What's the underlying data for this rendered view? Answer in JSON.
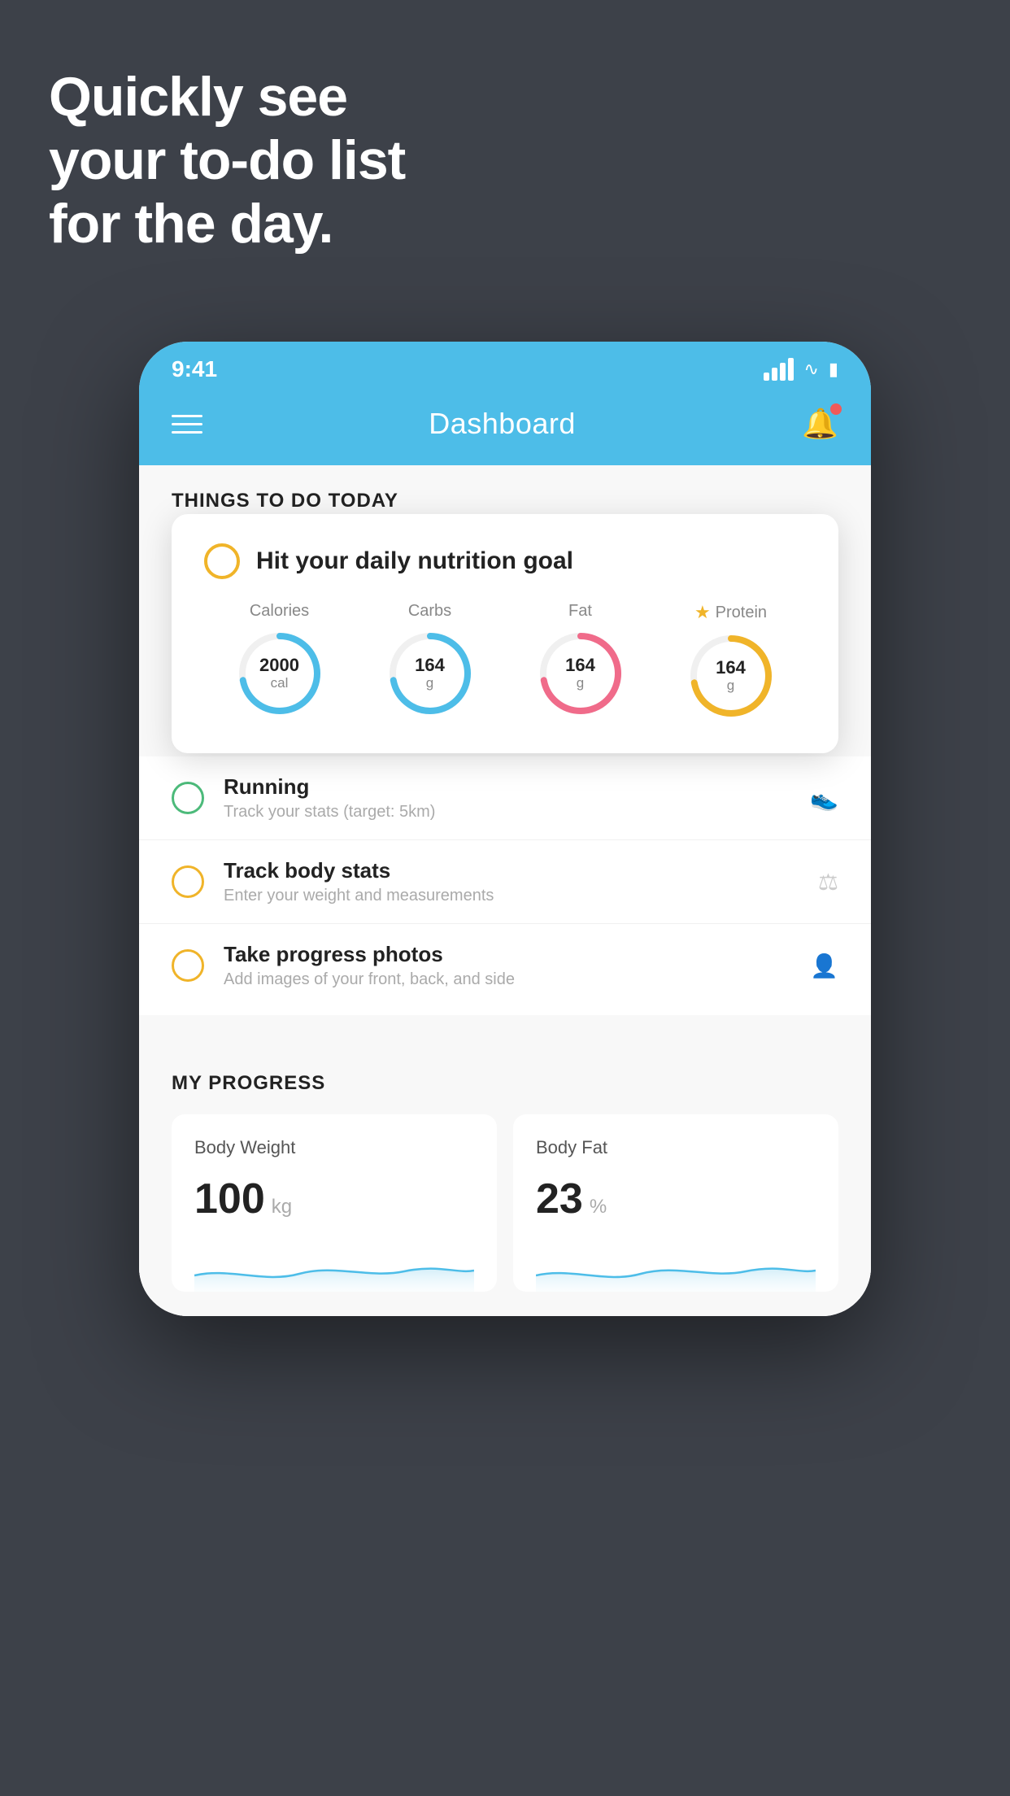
{
  "hero": {
    "line1": "Quickly see",
    "line2": "your to-do list",
    "line3": "for the day."
  },
  "status_bar": {
    "time": "9:41"
  },
  "header": {
    "title": "Dashboard"
  },
  "section1": {
    "label": "THINGS TO DO TODAY"
  },
  "floating_card": {
    "title": "Hit your daily nutrition goal",
    "nutrients": [
      {
        "label": "Calories",
        "value": "2000",
        "unit": "cal",
        "color_class": "ring-calories",
        "stroke_dasharray": "220 280",
        "star": false
      },
      {
        "label": "Carbs",
        "value": "164",
        "unit": "g",
        "color_class": "ring-carbs",
        "stroke_dasharray": "180 280",
        "star": false
      },
      {
        "label": "Fat",
        "value": "164",
        "unit": "g",
        "color_class": "ring-fat",
        "stroke_dasharray": "160 280",
        "star": false
      },
      {
        "label": "Protein",
        "value": "164",
        "unit": "g",
        "color_class": "ring-protein",
        "stroke_dasharray": "200 280",
        "star": true
      }
    ]
  },
  "todo_list": [
    {
      "title": "Running",
      "subtitle": "Track your stats (target: 5km)",
      "circle": "green",
      "icon": "👟"
    },
    {
      "title": "Track body stats",
      "subtitle": "Enter your weight and measurements",
      "circle": "yellow",
      "icon": "⚖"
    },
    {
      "title": "Take progress photos",
      "subtitle": "Add images of your front, back, and side",
      "circle": "yellow",
      "icon": "👤"
    }
  ],
  "progress": {
    "section_title": "MY PROGRESS",
    "cards": [
      {
        "title": "Body Weight",
        "value": "100",
        "unit": "kg"
      },
      {
        "title": "Body Fat",
        "value": "23",
        "unit": "%"
      }
    ]
  }
}
